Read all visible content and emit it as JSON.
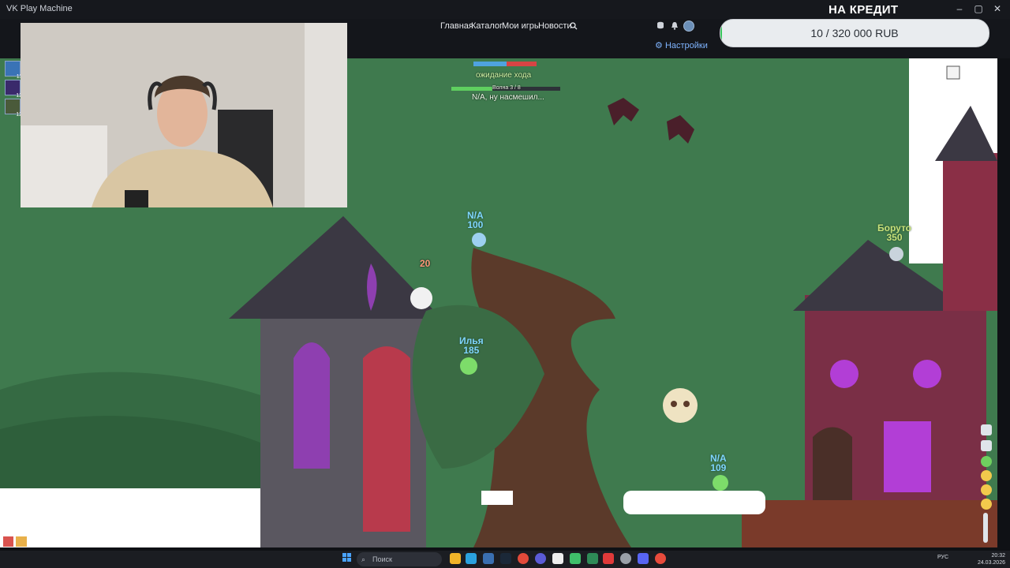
{
  "window": {
    "title": "VK Play Machine",
    "controls": [
      "–",
      "▢",
      "✕"
    ]
  },
  "navbar": {
    "items": [
      "Главная",
      "Каталог",
      "Мои игры",
      "Новости"
    ],
    "search_icon": "search-icon",
    "settings_label": "Настройки"
  },
  "credit": {
    "title": "НА КРЕДИТ",
    "text": "10 / 320 000 RUB",
    "progress": 3e-05
  },
  "hud": {
    "status": "ожидание хода",
    "wave": "Волна 3 / 8",
    "message": "N/A, ну насмешил...",
    "damage_popup": "20"
  },
  "worms": [
    {
      "name": "N/A",
      "hp": "100",
      "color": "#7fd6ff"
    },
    {
      "name": "Илья",
      "hp": "185",
      "color": "#7fd6ff"
    },
    {
      "name": "N/A",
      "hp": "109",
      "color": "#7fd6ff"
    },
    {
      "name": "Боруто",
      "hp": "350",
      "color": "#c8e27a"
    }
  ],
  "side_thumbs": [
    "11",
    "12",
    "12"
  ],
  "taskbar": {
    "search_placeholder": "Поиск",
    "lang": "РУС",
    "time": "20:32",
    "date": "24.03.2026"
  },
  "colors": {
    "sky": "#3f7a4e",
    "accent": "#34c759",
    "settings": "#7fb4ff"
  }
}
